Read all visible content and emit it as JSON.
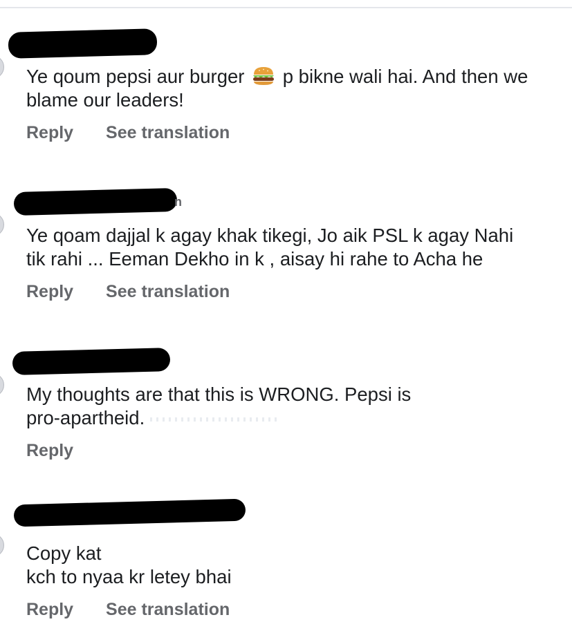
{
  "comments": [
    {
      "text_before_icon": "Ye qoum pepsi aur burger ",
      "icon": "burger-icon",
      "text_after_icon": " p bikne wali hai. And then we\nblame our leaders!",
      "reply_label": "Reply",
      "translate_label": "See translation"
    },
    {
      "text": "Ye qoam dajjal k agay khak tikegi, Jo aik PSL k agay Nahi\ntik rahi ... Eeman Dekho in k , aisay hi rahe to Acha he",
      "reply_label": "Reply",
      "translate_label": "See translation"
    },
    {
      "text": "My thoughts are that this is WRONG. Pepsi is\npro-apartheid.",
      "reply_label": "Reply"
    },
    {
      "text": "Copy kat\nkch to nyaa kr letey bhai",
      "reply_label": "Reply",
      "translate_label": "See translation"
    }
  ],
  "colors": {
    "text": "#1c1e21",
    "secondary": "#65676b",
    "divider": "#e4e6eb",
    "redaction": "#000000"
  }
}
